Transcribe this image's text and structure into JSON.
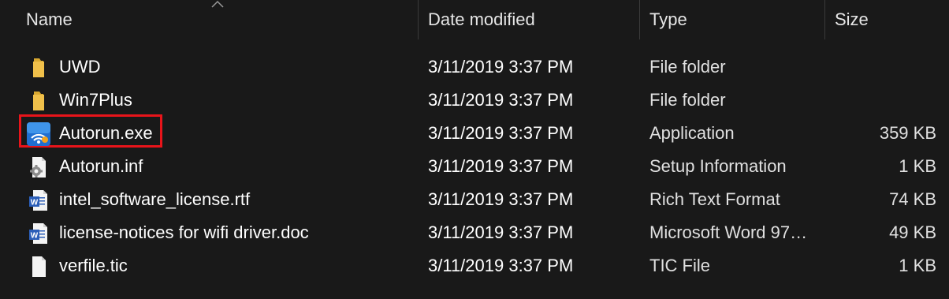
{
  "columns": {
    "name": "Name",
    "date_modified": "Date modified",
    "type": "Type",
    "size": "Size"
  },
  "files": [
    {
      "name": "UWD",
      "date": "3/11/2019 3:37 PM",
      "type": "File folder",
      "size": "",
      "icon": "folder-icon"
    },
    {
      "name": "Win7Plus",
      "date": "3/11/2019 3:37 PM",
      "type": "File folder",
      "size": "",
      "icon": "folder-icon"
    },
    {
      "name": "Autorun.exe",
      "date": "3/11/2019 3:37 PM",
      "type": "Application",
      "size": "359 KB",
      "icon": "wifi-app-icon"
    },
    {
      "name": "Autorun.inf",
      "date": "3/11/2019 3:37 PM",
      "type": "Setup Information",
      "size": "1 KB",
      "icon": "setup-gear-icon"
    },
    {
      "name": "intel_software_license.rtf",
      "date": "3/11/2019 3:37 PM",
      "type": "Rich Text Format",
      "size": "74 KB",
      "icon": "word-doc-icon"
    },
    {
      "name": "license-notices for wifi driver.doc",
      "date": "3/11/2019 3:37 PM",
      "type": "Microsoft Word 97…",
      "size": "49 KB",
      "icon": "word-doc-icon"
    },
    {
      "name": "verfile.tic",
      "date": "3/11/2019 3:37 PM",
      "type": "TIC File",
      "size": "1 KB",
      "icon": "blank-file-icon"
    }
  ],
  "colors": {
    "background": "#191919",
    "folder": "#f0c04a",
    "highlight": "#e8141a",
    "word_blue": "#2b5eb8"
  }
}
